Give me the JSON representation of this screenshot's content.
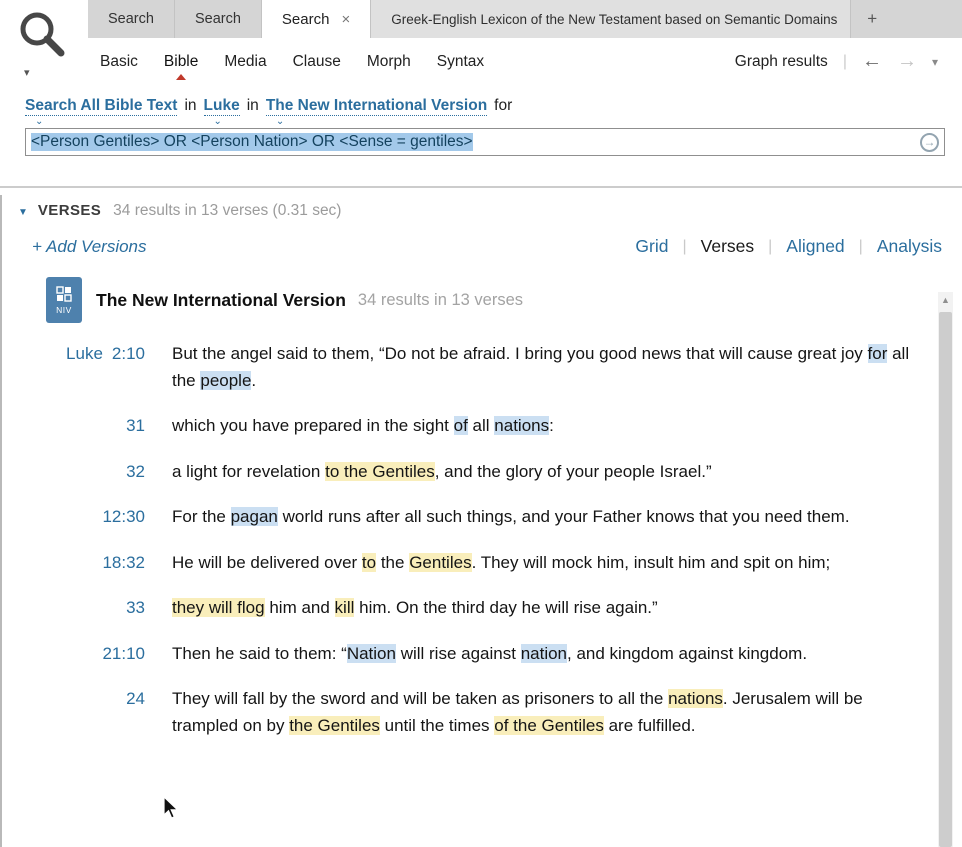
{
  "colors": {
    "accent": "#2b6e9e",
    "hl_blue": "#cbdff2",
    "hl_yellow": "#f9eebb",
    "sel": "#a3c9ea"
  },
  "icons": {
    "search_magnifier": "magnifier",
    "small_caret": "▾",
    "link_caret": "⌄",
    "back_arrow": "←",
    "forward_arrow": "→",
    "collapse_triangle": "▼",
    "scroll_up": "▲",
    "submit_arrow": "→",
    "close": "×"
  },
  "tabbar": {
    "tabs": [
      {
        "label": "Search"
      },
      {
        "label": "Search"
      },
      {
        "label": "Search",
        "active": true,
        "close": "×"
      },
      {
        "label": "Greek-English Lexicon of the New Testament based on Semantic Domains",
        "wide": true
      },
      {
        "label": "+",
        "plus": true
      }
    ]
  },
  "menubar": {
    "items": [
      {
        "label": "Basic"
      },
      {
        "label": "Bible",
        "active": true
      },
      {
        "label": "Media"
      },
      {
        "label": "Clause"
      },
      {
        "label": "Morph"
      },
      {
        "label": "Syntax"
      }
    ],
    "graph_results": "Graph results"
  },
  "scope": {
    "parts": [
      {
        "text": "Search All Bible Text",
        "link": true
      },
      {
        "text": "in"
      },
      {
        "text": "Luke",
        "link": true
      },
      {
        "text": "in"
      },
      {
        "text": "The New International Version",
        "link": true
      },
      {
        "text": "for"
      }
    ]
  },
  "search": {
    "query": "<Person Gentiles> OR <Person Nation> OR <Sense = gentiles>"
  },
  "results_header": {
    "section": "VERSES",
    "summary": "34 results in 13 verses (0.31 sec)"
  },
  "controls": {
    "add_versions": "+ Add Versions",
    "views": [
      {
        "label": "Grid"
      },
      {
        "label": "Verses",
        "active": true
      },
      {
        "label": "Aligned"
      },
      {
        "label": "Analysis"
      }
    ]
  },
  "version": {
    "abbr": "NIV",
    "name": "The New International Version",
    "summary": "34 results in 13 verses"
  },
  "verses": [
    {
      "book": "Luke",
      "ref": "2:10",
      "segments": [
        {
          "t": "But the angel said to them, “Do not be afraid. I bring you good news that will cause great joy "
        },
        {
          "t": "for",
          "h": "blue"
        },
        {
          "t": " all the "
        },
        {
          "t": "people",
          "h": "blue"
        },
        {
          "t": "."
        }
      ]
    },
    {
      "book": "",
      "ref": "31",
      "segments": [
        {
          "t": "which you have prepared in the sight "
        },
        {
          "t": "of",
          "h": "blue"
        },
        {
          "t": " all "
        },
        {
          "t": "nations",
          "h": "blue"
        },
        {
          "t": ":"
        }
      ]
    },
    {
      "book": "",
      "ref": "32",
      "segments": [
        {
          "t": "a light for revelation "
        },
        {
          "t": "to the Gentiles",
          "h": "yellow"
        },
        {
          "t": ", and the glory of your people Israel.”"
        }
      ]
    },
    {
      "book": "",
      "ref": "12:30",
      "segments": [
        {
          "t": "For the "
        },
        {
          "t": "pagan",
          "h": "blue"
        },
        {
          "t": " world runs after all such things, and your Father knows that you need them."
        }
      ]
    },
    {
      "book": "",
      "ref": "18:32",
      "segments": [
        {
          "t": "He will be delivered over "
        },
        {
          "t": "to",
          "h": "yellow"
        },
        {
          "t": " the "
        },
        {
          "t": "Gentiles",
          "h": "yellow"
        },
        {
          "t": ". They will mock him, insult him and spit on him;"
        }
      ]
    },
    {
      "book": "",
      "ref": "33",
      "segments": [
        {
          "t": "they will flog",
          "h": "yellow"
        },
        {
          "t": " him and "
        },
        {
          "t": "kill",
          "h": "yellow"
        },
        {
          "t": " him. On the third day he will rise again.”"
        }
      ]
    },
    {
      "book": "",
      "ref": "21:10",
      "segments": [
        {
          "t": "Then he said to them: “"
        },
        {
          "t": "Nation",
          "h": "blue"
        },
        {
          "t": " will rise against "
        },
        {
          "t": "nation",
          "h": "blue"
        },
        {
          "t": ", and kingdom against kingdom."
        }
      ]
    },
    {
      "book": "",
      "ref": "24",
      "segments": [
        {
          "t": "They will fall by the sword and will be taken as prisoners to all the "
        },
        {
          "t": "nations",
          "h": "yellow"
        },
        {
          "t": ". Jerusalem will be trampled on by "
        },
        {
          "t": "the Gentiles",
          "h": "yellow"
        },
        {
          "t": " until the times "
        },
        {
          "t": "of the Gentiles",
          "h": "yellow"
        },
        {
          "t": " are fulfilled."
        }
      ]
    }
  ]
}
